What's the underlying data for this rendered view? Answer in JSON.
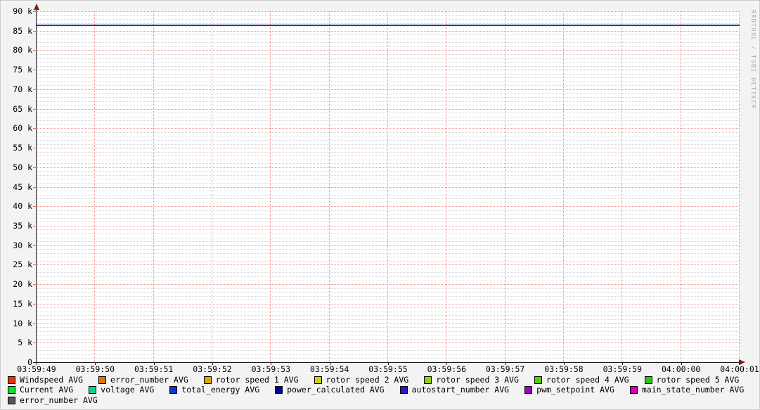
{
  "watermark": "RRDTOOL / TOBI OETIKER",
  "chart_data": {
    "type": "line",
    "title": "",
    "grid": "on",
    "legend_position": "bottom",
    "x_tick_labels": [
      "03:59:49",
      "03:59:50",
      "03:59:51",
      "03:59:52",
      "03:59:53",
      "03:59:54",
      "03:59:55",
      "03:59:56",
      "03:59:57",
      "03:59:58",
      "03:59:59",
      "04:00:00",
      "04:00:01"
    ],
    "y_axis": {
      "min": 0,
      "max": 90000,
      "major_step": 5000,
      "minor_step": 1000
    },
    "y_tick_labels": [
      "0",
      "5 k",
      "10 k",
      "15 k",
      "20 k",
      "25 k",
      "30 k",
      "35 k",
      "40 k",
      "45 k",
      "50 k",
      "55 k",
      "60 k",
      "65 k",
      "70 k",
      "75 k",
      "80 k",
      "85 k",
      "90 k"
    ],
    "series": [
      {
        "name": "total_energy AVG",
        "color": "#0D38C8",
        "values": [
          86400,
          86400,
          86400,
          86400,
          86400,
          86400,
          86400,
          86400,
          86400,
          86400,
          86400,
          86400,
          86400
        ]
      }
    ]
  },
  "legend": {
    "rows": [
      [
        {
          "label": "Windspeed AVG",
          "color": "#E73305"
        },
        {
          "label": "error_number AVG",
          "color": "#E07800"
        },
        {
          "label": "rotor speed 1 AVG",
          "color": "#D8A800"
        },
        {
          "label": "rotor speed 2 AVG",
          "color": "#CCD500"
        },
        {
          "label": "rotor speed 3 AVG",
          "color": "#8FD500"
        },
        {
          "label": "rotor speed 4 AVG",
          "color": "#4FD300"
        },
        {
          "label": "rotor speed 5 AVG",
          "color": "#21CE06"
        }
      ],
      [
        {
          "label": "Current AVG",
          "color": "#0CE225"
        },
        {
          "label": "voltage AVG",
          "color": "#00D793"
        },
        {
          "label": "total_energy AVG",
          "color": "#0D38C8"
        },
        {
          "label": "power_calculated AVG",
          "color": "#0000A8"
        },
        {
          "label": "autostart_number AVG",
          "color": "#3A10C8"
        },
        {
          "label": "pwm_setpoint AVG",
          "color": "#9D00C8"
        },
        {
          "label": "main_state_number AVG",
          "color": "#DB00B0"
        }
      ],
      [
        {
          "label": "error_number AVG",
          "color": "#555555"
        }
      ]
    ]
  }
}
